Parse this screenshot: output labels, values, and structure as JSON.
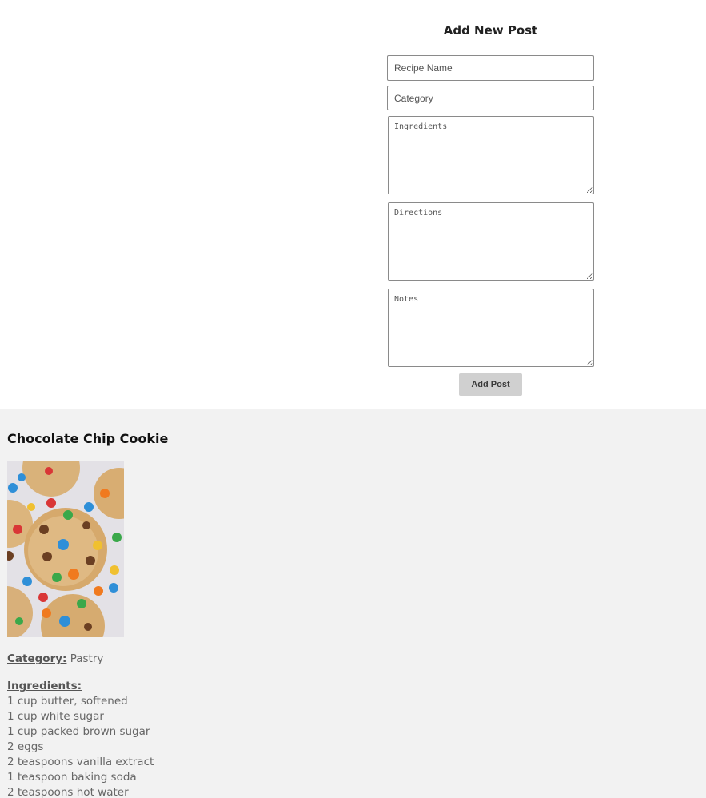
{
  "form": {
    "title": "Add New Post",
    "recipe_name_placeholder": "Recipe Name",
    "category_placeholder": "Category",
    "ingredients_placeholder": "Ingredients",
    "directions_placeholder": "Directions",
    "notes_placeholder": "Notes",
    "submit_label": "Add Post"
  },
  "post": {
    "title": "Chocolate Chip Cookie",
    "image_icon": "cookie-photo",
    "category_label": "Category:",
    "category_value": "Pastry",
    "ingredients_label": "Ingredients:",
    "ingredients": [
      "1 cup butter, softened",
      "1 cup white sugar",
      "1 cup packed brown sugar",
      "2 eggs",
      "2 teaspoons vanilla extract",
      "1 teaspoon baking soda",
      "2 teaspoons hot water"
    ]
  },
  "colors": {
    "posts_background": "#f2f2f2",
    "button_background": "#d0d0d0"
  }
}
